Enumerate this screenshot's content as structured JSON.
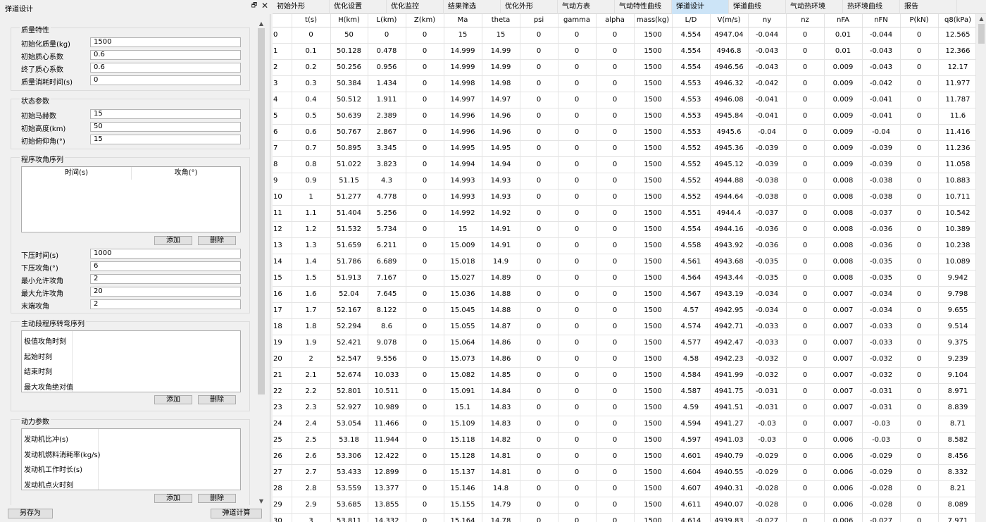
{
  "panel": {
    "title": "弹道设计",
    "float_glyph": "🗗",
    "close_glyph": "✕"
  },
  "mass": {
    "title": "质量特性",
    "rows": [
      {
        "label": "初始化质量(kg)",
        "value": "1500"
      },
      {
        "label": "初始质心系数",
        "value": "0.6"
      },
      {
        "label": "终了质心系数",
        "value": "0.6"
      },
      {
        "label": "质量消耗时间(s)",
        "value": "0"
      }
    ]
  },
  "state": {
    "title": "状态参数",
    "rows": [
      {
        "label": "初始马赫数",
        "value": "15"
      },
      {
        "label": "初始高度(km)",
        "value": "50"
      },
      {
        "label": "初始俯仰角(°)",
        "value": "15"
      }
    ]
  },
  "program": {
    "title": "程序攻角序列",
    "col_time": "时间(s)",
    "col_alpha": "攻角(°)",
    "add_label": "添加",
    "delete_label": "删除",
    "rows": [
      {
        "label": "下压时间(s)",
        "value": "1000"
      },
      {
        "label": "下压攻角(°)",
        "value": "6"
      },
      {
        "label": "最小允许攻角",
        "value": "2"
      },
      {
        "label": "最大允许攻角",
        "value": "20"
      },
      {
        "label": "末端攻角",
        "value": "2"
      }
    ]
  },
  "active": {
    "title": "主动段程序转弯序列",
    "items": [
      "极值攻角时刻",
      "起始时刻",
      "结束时刻",
      "最大攻角绝对值"
    ],
    "add_label": "添加",
    "delete_label": "删除"
  },
  "power": {
    "title": "动力参数",
    "items": [
      "发动机比冲(s)",
      "发动机燃料消耗率(kg/s)",
      "发动机工作时长(s)",
      "发动机点火时刻"
    ],
    "add_label": "添加",
    "delete_label": "删除"
  },
  "bottom": {
    "save_as": "另存为",
    "compute": "弹道计算"
  },
  "scroll_glyphs": {
    "up": "▲",
    "down": "▼"
  },
  "tabs": [
    {
      "label": "初始外形",
      "active": false
    },
    {
      "label": "优化设置",
      "active": false
    },
    {
      "label": "优化监控",
      "active": false
    },
    {
      "label": "结果筛选",
      "active": false
    },
    {
      "label": "优化外形",
      "active": false
    },
    {
      "label": "气动方表",
      "active": false
    },
    {
      "label": "气动特性曲线",
      "active": false
    },
    {
      "label": "弹道设计",
      "active": true
    },
    {
      "label": "弹道曲线",
      "active": false
    },
    {
      "label": "气动热环境",
      "active": false
    },
    {
      "label": "热环境曲线",
      "active": false
    },
    {
      "label": "报告",
      "active": false
    }
  ],
  "table": {
    "columns": [
      "",
      "t(s)",
      "H(km)",
      "L(km)",
      "Z(km)",
      "Ma",
      "theta",
      "psi",
      "gamma",
      "alpha",
      "mass(kg)",
      "L/D",
      "V(m/s)",
      "ny",
      "nz",
      "nFA",
      "nFN",
      "P(kN)",
      "q8(kPa)"
    ],
    "rows": [
      [
        "0",
        "0",
        "50",
        "0",
        "0",
        "15",
        "15",
        "0",
        "0",
        "0",
        "1500",
        "4.554",
        "4947.04",
        "-0.044",
        "0",
        "0.01",
        "-0.044",
        "0",
        "12.565"
      ],
      [
        "1",
        "0.1",
        "50.128",
        "0.478",
        "0",
        "14.999",
        "14.99",
        "0",
        "0",
        "0",
        "1500",
        "4.554",
        "4946.8",
        "-0.043",
        "0",
        "0.01",
        "-0.043",
        "0",
        "12.366"
      ],
      [
        "2",
        "0.2",
        "50.256",
        "0.956",
        "0",
        "14.999",
        "14.99",
        "0",
        "0",
        "0",
        "1500",
        "4.554",
        "4946.56",
        "-0.043",
        "0",
        "0.009",
        "-0.043",
        "0",
        "12.17"
      ],
      [
        "3",
        "0.3",
        "50.384",
        "1.434",
        "0",
        "14.998",
        "14.98",
        "0",
        "0",
        "0",
        "1500",
        "4.553",
        "4946.32",
        "-0.042",
        "0",
        "0.009",
        "-0.042",
        "0",
        "11.977"
      ],
      [
        "4",
        "0.4",
        "50.512",
        "1.911",
        "0",
        "14.997",
        "14.97",
        "0",
        "0",
        "0",
        "1500",
        "4.553",
        "4946.08",
        "-0.041",
        "0",
        "0.009",
        "-0.041",
        "0",
        "11.787"
      ],
      [
        "5",
        "0.5",
        "50.639",
        "2.389",
        "0",
        "14.996",
        "14.96",
        "0",
        "0",
        "0",
        "1500",
        "4.553",
        "4945.84",
        "-0.041",
        "0",
        "0.009",
        "-0.041",
        "0",
        "11.6"
      ],
      [
        "6",
        "0.6",
        "50.767",
        "2.867",
        "0",
        "14.996",
        "14.96",
        "0",
        "0",
        "0",
        "1500",
        "4.553",
        "4945.6",
        "-0.04",
        "0",
        "0.009",
        "-0.04",
        "0",
        "11.416"
      ],
      [
        "7",
        "0.7",
        "50.895",
        "3.345",
        "0",
        "14.995",
        "14.95",
        "0",
        "0",
        "0",
        "1500",
        "4.552",
        "4945.36",
        "-0.039",
        "0",
        "0.009",
        "-0.039",
        "0",
        "11.236"
      ],
      [
        "8",
        "0.8",
        "51.022",
        "3.823",
        "0",
        "14.994",
        "14.94",
        "0",
        "0",
        "0",
        "1500",
        "4.552",
        "4945.12",
        "-0.039",
        "0",
        "0.009",
        "-0.039",
        "0",
        "11.058"
      ],
      [
        "9",
        "0.9",
        "51.15",
        "4.3",
        "0",
        "14.993",
        "14.93",
        "0",
        "0",
        "0",
        "1500",
        "4.552",
        "4944.88",
        "-0.038",
        "0",
        "0.008",
        "-0.038",
        "0",
        "10.883"
      ],
      [
        "10",
        "1",
        "51.277",
        "4.778",
        "0",
        "14.993",
        "14.93",
        "0",
        "0",
        "0",
        "1500",
        "4.552",
        "4944.64",
        "-0.038",
        "0",
        "0.008",
        "-0.038",
        "0",
        "10.711"
      ],
      [
        "11",
        "1.1",
        "51.404",
        "5.256",
        "0",
        "14.992",
        "14.92",
        "0",
        "0",
        "0",
        "1500",
        "4.551",
        "4944.4",
        "-0.037",
        "0",
        "0.008",
        "-0.037",
        "0",
        "10.542"
      ],
      [
        "12",
        "1.2",
        "51.532",
        "5.734",
        "0",
        "15",
        "14.91",
        "0",
        "0",
        "0",
        "1500",
        "4.554",
        "4944.16",
        "-0.036",
        "0",
        "0.008",
        "-0.036",
        "0",
        "10.389"
      ],
      [
        "13",
        "1.3",
        "51.659",
        "6.211",
        "0",
        "15.009",
        "14.91",
        "0",
        "0",
        "0",
        "1500",
        "4.558",
        "4943.92",
        "-0.036",
        "0",
        "0.008",
        "-0.036",
        "0",
        "10.238"
      ],
      [
        "14",
        "1.4",
        "51.786",
        "6.689",
        "0",
        "15.018",
        "14.9",
        "0",
        "0",
        "0",
        "1500",
        "4.561",
        "4943.68",
        "-0.035",
        "0",
        "0.008",
        "-0.035",
        "0",
        "10.089"
      ],
      [
        "15",
        "1.5",
        "51.913",
        "7.167",
        "0",
        "15.027",
        "14.89",
        "0",
        "0",
        "0",
        "1500",
        "4.564",
        "4943.44",
        "-0.035",
        "0",
        "0.008",
        "-0.035",
        "0",
        "9.942"
      ],
      [
        "16",
        "1.6",
        "52.04",
        "7.645",
        "0",
        "15.036",
        "14.88",
        "0",
        "0",
        "0",
        "1500",
        "4.567",
        "4943.19",
        "-0.034",
        "0",
        "0.007",
        "-0.034",
        "0",
        "9.798"
      ],
      [
        "17",
        "1.7",
        "52.167",
        "8.122",
        "0",
        "15.045",
        "14.88",
        "0",
        "0",
        "0",
        "1500",
        "4.57",
        "4942.95",
        "-0.034",
        "0",
        "0.007",
        "-0.034",
        "0",
        "9.655"
      ],
      [
        "18",
        "1.8",
        "52.294",
        "8.6",
        "0",
        "15.055",
        "14.87",
        "0",
        "0",
        "0",
        "1500",
        "4.574",
        "4942.71",
        "-0.033",
        "0",
        "0.007",
        "-0.033",
        "0",
        "9.514"
      ],
      [
        "19",
        "1.9",
        "52.421",
        "9.078",
        "0",
        "15.064",
        "14.86",
        "0",
        "0",
        "0",
        "1500",
        "4.577",
        "4942.47",
        "-0.033",
        "0",
        "0.007",
        "-0.033",
        "0",
        "9.375"
      ],
      [
        "20",
        "2",
        "52.547",
        "9.556",
        "0",
        "15.073",
        "14.86",
        "0",
        "0",
        "0",
        "1500",
        "4.58",
        "4942.23",
        "-0.032",
        "0",
        "0.007",
        "-0.032",
        "0",
        "9.239"
      ],
      [
        "21",
        "2.1",
        "52.674",
        "10.033",
        "0",
        "15.082",
        "14.85",
        "0",
        "0",
        "0",
        "1500",
        "4.584",
        "4941.99",
        "-0.032",
        "0",
        "0.007",
        "-0.032",
        "0",
        "9.104"
      ],
      [
        "22",
        "2.2",
        "52.801",
        "10.511",
        "0",
        "15.091",
        "14.84",
        "0",
        "0",
        "0",
        "1500",
        "4.587",
        "4941.75",
        "-0.031",
        "0",
        "0.007",
        "-0.031",
        "0",
        "8.971"
      ],
      [
        "23",
        "2.3",
        "52.927",
        "10.989",
        "0",
        "15.1",
        "14.83",
        "0",
        "0",
        "0",
        "1500",
        "4.59",
        "4941.51",
        "-0.031",
        "0",
        "0.007",
        "-0.031",
        "0",
        "8.839"
      ],
      [
        "24",
        "2.4",
        "53.054",
        "11.466",
        "0",
        "15.109",
        "14.83",
        "0",
        "0",
        "0",
        "1500",
        "4.594",
        "4941.27",
        "-0.03",
        "0",
        "0.007",
        "-0.03",
        "0",
        "8.71"
      ],
      [
        "25",
        "2.5",
        "53.18",
        "11.944",
        "0",
        "15.118",
        "14.82",
        "0",
        "0",
        "0",
        "1500",
        "4.597",
        "4941.03",
        "-0.03",
        "0",
        "0.006",
        "-0.03",
        "0",
        "8.582"
      ],
      [
        "26",
        "2.6",
        "53.306",
        "12.422",
        "0",
        "15.128",
        "14.81",
        "0",
        "0",
        "0",
        "1500",
        "4.601",
        "4940.79",
        "-0.029",
        "0",
        "0.006",
        "-0.029",
        "0",
        "8.456"
      ],
      [
        "27",
        "2.7",
        "53.433",
        "12.899",
        "0",
        "15.137",
        "14.81",
        "0",
        "0",
        "0",
        "1500",
        "4.604",
        "4940.55",
        "-0.029",
        "0",
        "0.006",
        "-0.029",
        "0",
        "8.332"
      ],
      [
        "28",
        "2.8",
        "53.559",
        "13.377",
        "0",
        "15.146",
        "14.8",
        "0",
        "0",
        "0",
        "1500",
        "4.607",
        "4940.31",
        "-0.028",
        "0",
        "0.006",
        "-0.028",
        "0",
        "8.21"
      ],
      [
        "29",
        "2.9",
        "53.685",
        "13.855",
        "0",
        "15.155",
        "14.79",
        "0",
        "0",
        "0",
        "1500",
        "4.611",
        "4940.07",
        "-0.028",
        "0",
        "0.006",
        "-0.028",
        "0",
        "8.089"
      ],
      [
        "30",
        "3",
        "53.811",
        "14.332",
        "0",
        "15.164",
        "14.78",
        "0",
        "0",
        "0",
        "1500",
        "4.614",
        "4939.83",
        "-0.027",
        "0",
        "0.006",
        "-0.027",
        "0",
        "7.971"
      ]
    ]
  }
}
